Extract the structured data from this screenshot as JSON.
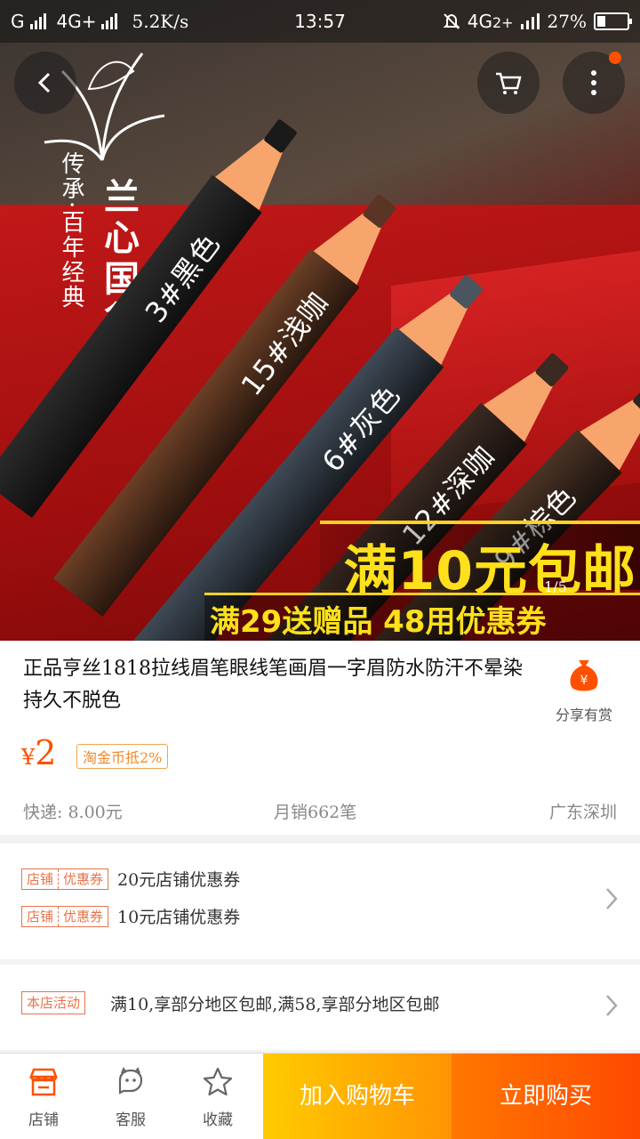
{
  "status_bar": {
    "carrier": "G",
    "network1": "4G+",
    "speed": "5.2K/s",
    "time": "13:57",
    "network2": "4G",
    "network2_sub": "2+",
    "battery": "27%",
    "battery_level": 0.27
  },
  "gallery": {
    "brand_name": "兰心国货",
    "brand_slogan": "传承·百年经典",
    "pencils": [
      {
        "label": "3#黑色",
        "color": "#2a2a2a",
        "lead": "#1a1a1a"
      },
      {
        "label": "15#浅咖",
        "color": "#6b3f26",
        "lead": "#5a3424"
      },
      {
        "label": "6#灰色",
        "color": "#3f4a56",
        "lead": "#4a5560"
      },
      {
        "label": "12#深咖",
        "color": "#3a2a22",
        "lead": "#3a2a22"
      },
      {
        "label": "9#棕色",
        "color": "#4a3326",
        "lead": "#2f2420"
      }
    ],
    "promo_line1": "满10元包邮",
    "promo_line2": "满29送赠品  48用优惠券",
    "page_indicator": "1/5"
  },
  "product": {
    "title": "正品亨丝1818拉线眉笔眼线笔画眉一字眉防水防汗不晕染持久不脱色",
    "share_label": "分享有赏",
    "price_currency": "¥",
    "price": "2",
    "coin_tag": "淘金币抵2%",
    "shipping": "快递: 8.00元",
    "monthly_sales": "月销662笔",
    "location": "广东深圳"
  },
  "coupons": {
    "items": [
      {
        "tag_left": "店铺",
        "tag_right": "优惠券",
        "text": "20元店铺优惠券"
      },
      {
        "tag_left": "店铺",
        "tag_right": "优惠券",
        "text": "10元店铺优惠券"
      }
    ]
  },
  "activity": {
    "tag": "本店活动",
    "text": "满10,享部分地区包邮,满58,享部分地区包邮"
  },
  "bottom_bar": {
    "shop_label": "店铺",
    "service_label": "客服",
    "favorite_label": "收藏",
    "add_to_cart": "加入购物车",
    "buy_now": "立即购买"
  },
  "colors": {
    "accent": "#ff5000",
    "cart_button": "#ff9402",
    "buy_button": "#ff4900"
  }
}
